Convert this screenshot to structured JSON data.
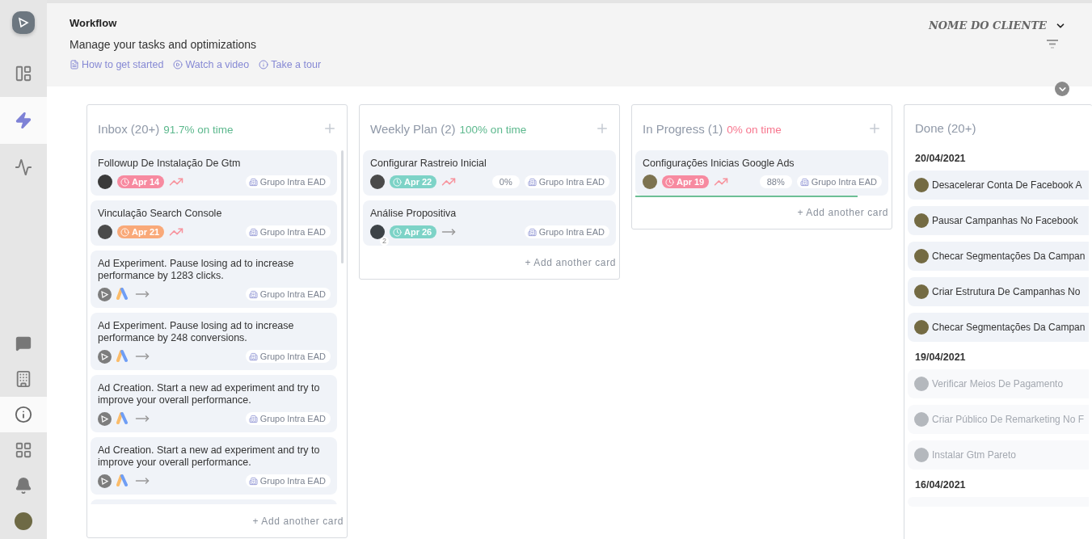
{
  "sidebar": {
    "top_items": [
      {
        "selected": false
      },
      {
        "selected": true
      },
      {
        "selected": false
      }
    ],
    "bottom_items": [
      {
        "selected": false
      },
      {
        "selected": false
      },
      {
        "selected": true
      },
      {
        "selected": false
      },
      {
        "selected": false
      },
      {
        "selected": false
      }
    ]
  },
  "header": {
    "title": "Workflow",
    "subtitle": "Manage your tasks and optimizations",
    "links": [
      {
        "label": "How to get started"
      },
      {
        "label": "Watch a video"
      },
      {
        "label": "Take a tour"
      }
    ],
    "client": "NOME DO CLIENTE"
  },
  "columns": [
    {
      "kind": "board",
      "title": "Inbox (20+)",
      "ontime": {
        "text": "91.7% on time",
        "color": "#5cb88d"
      },
      "add_label": "+ Add another card",
      "cards": [
        {
          "kind": "task",
          "title": "Followup De Instalação De Gtm",
          "due": {
            "label": "Apr 14",
            "color": "#f78aa0"
          },
          "trending": true,
          "client": "Grupo Intra EAD"
        },
        {
          "kind": "task",
          "title": "Vinculação Search Console",
          "due": {
            "label": "Apr 21",
            "color": "#f9a979"
          },
          "trending": true,
          "client": "Grupo Intra EAD"
        },
        {
          "kind": "suggestion",
          "title": "Ad Experiment. Pause losing ad to increase performance by 1283 clicks.",
          "client": "Grupo Intra EAD"
        },
        {
          "kind": "suggestion",
          "title": "Ad Experiment. Pause losing ad to increase performance by 248 conversions.",
          "client": "Grupo Intra EAD"
        },
        {
          "kind": "suggestion",
          "title": "Ad Creation. Start a new ad experiment and try to improve your overall performance.",
          "client": "Grupo Intra EAD"
        },
        {
          "kind": "suggestion",
          "title": "Ad Creation. Start a new ad experiment and try to improve your overall performance.",
          "client": "Grupo Intra EAD"
        }
      ]
    },
    {
      "kind": "board",
      "title": "Weekly Plan (2)",
      "ontime": {
        "text": "100% on time",
        "color": "#5cb88d"
      },
      "add_label": "+ Add another card",
      "cards": [
        {
          "kind": "task",
          "title": "Configurar Rastreio Inicial",
          "due": {
            "label": "Apr 22",
            "color": "#7dd3c7"
          },
          "trending": true,
          "progress": "0%",
          "client": "Grupo Intra EAD"
        },
        {
          "kind": "task",
          "title": "Análise Propositiva",
          "avatar_count": "2",
          "due": {
            "label": "Apr 26",
            "color": "#7dd3c7"
          },
          "trending": false,
          "client": "Grupo Intra EAD"
        }
      ]
    },
    {
      "kind": "board",
      "title": "In Progress (1)",
      "ontime": {
        "text": "0% on time",
        "color": "#f7768e"
      },
      "add_label": "+ Add another card",
      "cards": [
        {
          "kind": "task",
          "title": "Configurações Inicias Google Ads",
          "due": {
            "label": "Apr 19",
            "color": "#f78aa0"
          },
          "trending": true,
          "progress": "88%",
          "level": 0.88,
          "client": "Grupo Intra EAD"
        }
      ]
    },
    {
      "kind": "history",
      "title": "Done (20+)",
      "groups": [
        {
          "date": "20/04/2021",
          "faded": false,
          "items": [
            {
              "title": "Desacelerar Conta De Facebook A"
            },
            {
              "title": "Pausar Campanhas No Facebook"
            },
            {
              "title": "Checar Segmentações Da Campan"
            },
            {
              "title": "Criar Estrutura De Campanhas No"
            },
            {
              "title": "Checar Segmentações Da Campan"
            }
          ]
        },
        {
          "date": "19/04/2021",
          "faded": true,
          "items": [
            {
              "title": "Verificar Meios De Pagamento"
            },
            {
              "title": "Criar Público De Remarketing No F"
            },
            {
              "title": "Instalar Gtm Pareto"
            }
          ]
        },
        {
          "date": "16/04/2021"
        }
      ]
    }
  ]
}
